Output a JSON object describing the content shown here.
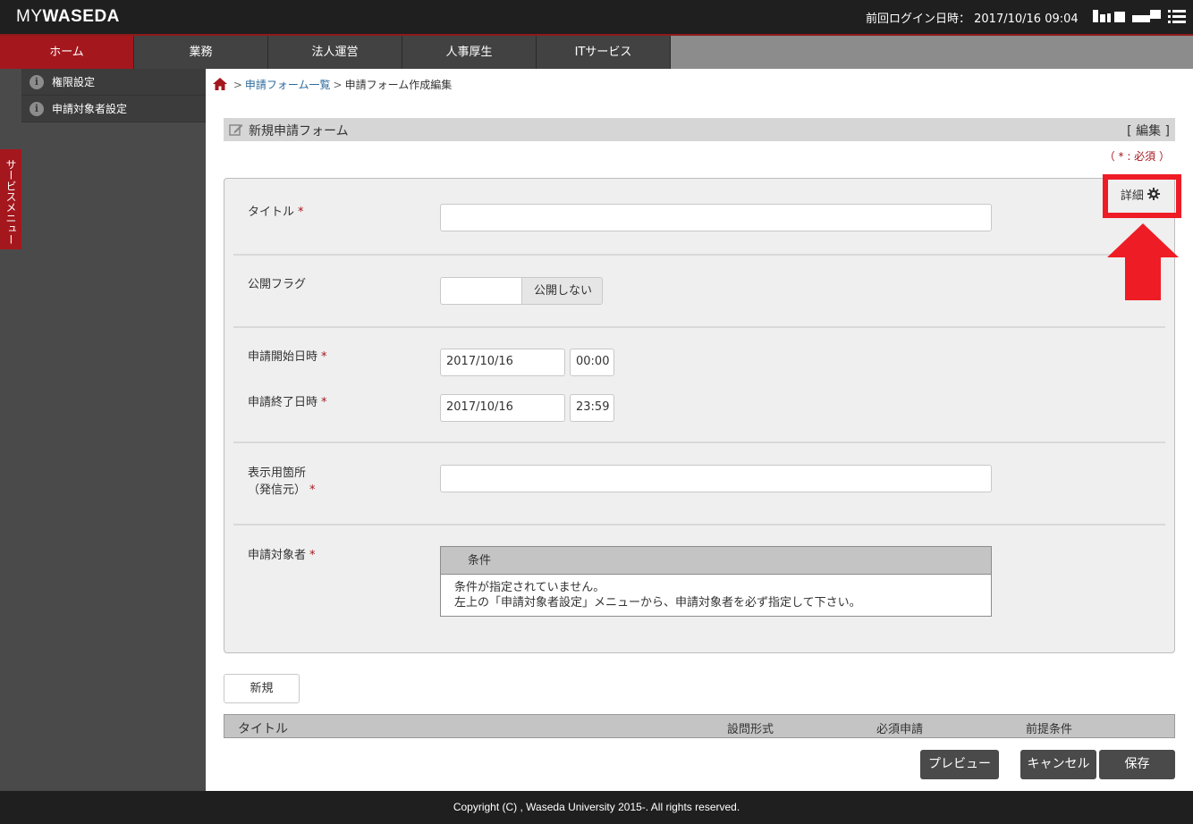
{
  "header": {
    "logo_my": "MY",
    "logo_waseda": "WASEDA",
    "last_login": "前回ログイン日時： 2017/10/16 09:04"
  },
  "nav": {
    "tabs": [
      {
        "label": "ホーム",
        "active": true
      },
      {
        "label": "業務",
        "active": false
      },
      {
        "label": "法人運営",
        "active": false
      },
      {
        "label": "人事厚生",
        "active": false
      },
      {
        "label": "ITサービス",
        "active": false
      }
    ]
  },
  "sidebar": {
    "service_menu_label": "サービスメニュー",
    "items": [
      {
        "label": "権限設定",
        "icon": "info-icon"
      },
      {
        "label": "申請対象者設定",
        "icon": "info-icon"
      }
    ]
  },
  "breadcrumb": {
    "item1": "申請フォーム一覧",
    "item2": "申請フォーム作成編集",
    "separator": ">"
  },
  "section": {
    "title": "新規申請フォーム",
    "edit_link": "[ 編集 ]",
    "required_note": "（ * : 必須 ）"
  },
  "form": {
    "detail_button": "詳細",
    "title_label": "タイトル",
    "title_value": "",
    "public_flag_label": "公開フラグ",
    "public_flag_value": "公開しない",
    "start_label": "申請開始日時",
    "start_date": "2017/10/16",
    "start_time": "00:00",
    "end_label": "申請終了日時",
    "end_date": "2017/10/16",
    "end_time": "23:59",
    "display_label_line1": "表示用箇所",
    "display_label_line2": "（発信元）",
    "display_value": "",
    "target_label": "申請対象者",
    "required_mark": "*",
    "condition_header": "条件",
    "condition_line1": "条件が指定されていません。",
    "condition_line2": "左上の「申請対象者設定」メニューから、申請対象者を必ず指定して下さい。"
  },
  "questions": {
    "new_button": "新規",
    "col_title": "タイトル",
    "col_type": "設問形式",
    "col_required": "必須申請",
    "col_precondition": "前提条件"
  },
  "actions": {
    "preview": "プレビュー",
    "cancel": "キャンセル",
    "save": "保存"
  },
  "footer": {
    "copyright": "Copyright (C) , Waseda University 2015-. All rights reserved."
  },
  "colors": {
    "brand_red": "#a4171d",
    "annotation_red": "#ee1c25",
    "header_bg": "#1f1f1f"
  }
}
